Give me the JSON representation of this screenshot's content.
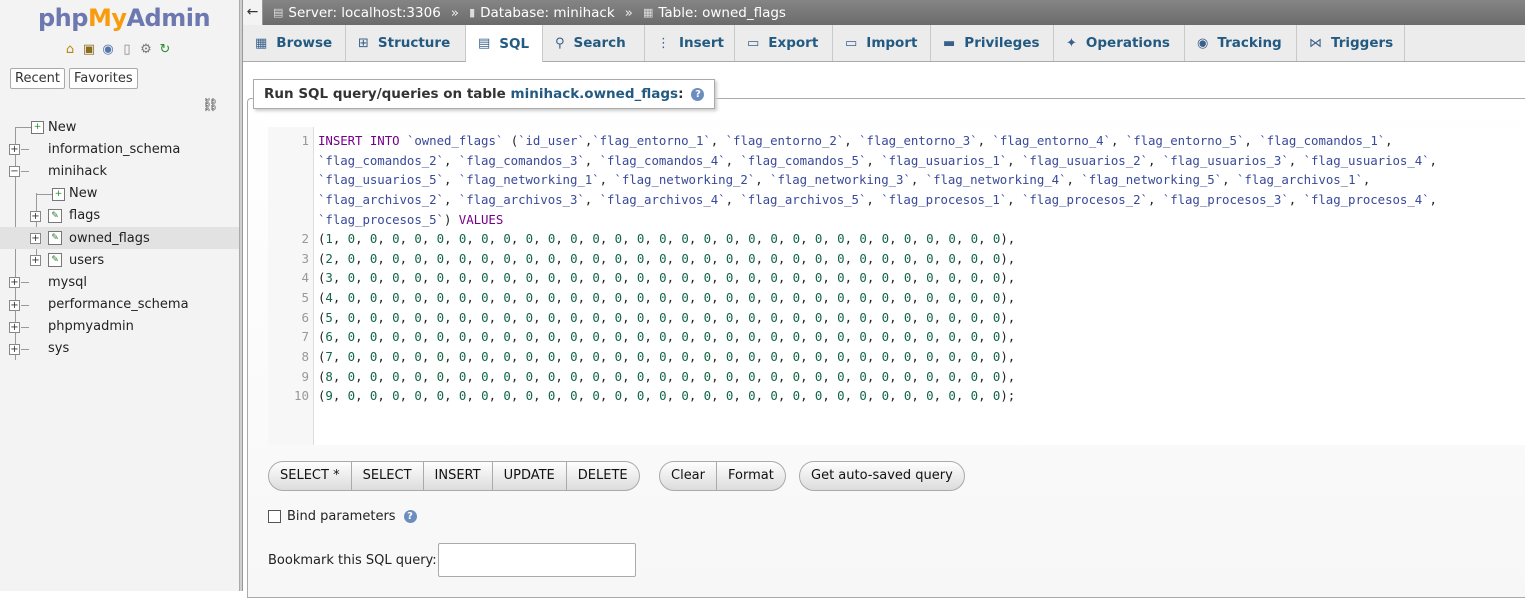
{
  "logo": {
    "php": "php",
    "my": "My",
    "admin": "Admin"
  },
  "nav": {
    "icons": [
      "home-icon",
      "exit-icon",
      "help-icon",
      "docs-icon",
      "settings-icon",
      "reload-icon"
    ],
    "tabs": [
      "Recent",
      "Favorites"
    ],
    "tree": [
      {
        "label": "New",
        "level": 0,
        "type": "new"
      },
      {
        "label": "information_schema",
        "level": 0,
        "type": "db"
      },
      {
        "label": "minihack",
        "level": 0,
        "type": "db-open"
      },
      {
        "label": "New",
        "level": 1,
        "type": "new"
      },
      {
        "label": "flags",
        "level": 1,
        "type": "table"
      },
      {
        "label": "owned_flags",
        "level": 1,
        "type": "table",
        "selected": true
      },
      {
        "label": "users",
        "level": 1,
        "type": "table"
      },
      {
        "label": "mysql",
        "level": 0,
        "type": "db"
      },
      {
        "label": "performance_schema",
        "level": 0,
        "type": "db"
      },
      {
        "label": "phpmyadmin",
        "level": 0,
        "type": "db"
      },
      {
        "label": "sys",
        "level": 0,
        "type": "db"
      }
    ]
  },
  "breadcrumb": {
    "server": "Server: localhost:3306",
    "database": "Database: minihack",
    "table": "Table: owned_flags",
    "sep": "»"
  },
  "tabs": [
    {
      "label": "Browse",
      "icon": "browse-icon"
    },
    {
      "label": "Structure",
      "icon": "structure-icon"
    },
    {
      "label": "SQL",
      "icon": "sql-icon",
      "active": true
    },
    {
      "label": "Search",
      "icon": "search-icon"
    },
    {
      "label": "Insert",
      "icon": "insert-icon"
    },
    {
      "label": "Export",
      "icon": "export-icon"
    },
    {
      "label": "Import",
      "icon": "import-icon"
    },
    {
      "label": "Privileges",
      "icon": "privileges-icon"
    },
    {
      "label": "Operations",
      "icon": "operations-icon"
    },
    {
      "label": "Tracking",
      "icon": "tracking-icon"
    },
    {
      "label": "Triggers",
      "icon": "triggers-icon"
    }
  ],
  "query_box": {
    "legend_prefix": "Run SQL query/queries on table ",
    "legend_table": "minihack.owned_flags",
    "legend_suffix": ":",
    "help": "?"
  },
  "sql": {
    "line1_rows": [
      "INSERT INTO `owned_flags` (`id_user`,`flag_entorno_1`, `flag_entorno_2`, `flag_entorno_3`, `flag_entorno_4`, `flag_entorno_5`, `flag_comandos_1`,",
      "`flag_comandos_2`, `flag_comandos_3`, `flag_comandos_4`, `flag_comandos_5`, `flag_usuarios_1`, `flag_usuarios_2`, `flag_usuarios_3`, `flag_usuarios_4`,",
      "`flag_usuarios_5`, `flag_networking_1`, `flag_networking_2`, `flag_networking_3`, `flag_networking_4`, `flag_networking_5`, `flag_archivos_1`,",
      "`flag_archivos_2`, `flag_archivos_3`, `flag_archivos_4`, `flag_archivos_5`, `flag_procesos_1`, `flag_procesos_2`, `flag_procesos_3`, `flag_procesos_4`,",
      "`flag_procesos_5`) VALUES"
    ],
    "value_rows": [
      "(1, 0, 0, 0, 0, 0, 0, 0, 0, 0, 0, 0, 0, 0, 0, 0, 0, 0, 0, 0, 0, 0, 0, 0, 0, 0, 0, 0, 0, 0, 0),",
      "(2, 0, 0, 0, 0, 0, 0, 0, 0, 0, 0, 0, 0, 0, 0, 0, 0, 0, 0, 0, 0, 0, 0, 0, 0, 0, 0, 0, 0, 0, 0),",
      "(3, 0, 0, 0, 0, 0, 0, 0, 0, 0, 0, 0, 0, 0, 0, 0, 0, 0, 0, 0, 0, 0, 0, 0, 0, 0, 0, 0, 0, 0, 0),",
      "(4, 0, 0, 0, 0, 0, 0, 0, 0, 0, 0, 0, 0, 0, 0, 0, 0, 0, 0, 0, 0, 0, 0, 0, 0, 0, 0, 0, 0, 0, 0),",
      "(5, 0, 0, 0, 0, 0, 0, 0, 0, 0, 0, 0, 0, 0, 0, 0, 0, 0, 0, 0, 0, 0, 0, 0, 0, 0, 0, 0, 0, 0, 0),",
      "(6, 0, 0, 0, 0, 0, 0, 0, 0, 0, 0, 0, 0, 0, 0, 0, 0, 0, 0, 0, 0, 0, 0, 0, 0, 0, 0, 0, 0, 0, 0),",
      "(7, 0, 0, 0, 0, 0, 0, 0, 0, 0, 0, 0, 0, 0, 0, 0, 0, 0, 0, 0, 0, 0, 0, 0, 0, 0, 0, 0, 0, 0, 0),",
      "(8, 0, 0, 0, 0, 0, 0, 0, 0, 0, 0, 0, 0, 0, 0, 0, 0, 0, 0, 0, 0, 0, 0, 0, 0, 0, 0, 0, 0, 0, 0),",
      "(9, 0, 0, 0, 0, 0, 0, 0, 0, 0, 0, 0, 0, 0, 0, 0, 0, 0, 0, 0, 0, 0, 0, 0, 0, 0, 0, 0, 0, 0, 0);"
    ],
    "line_numbers": [
      "1",
      "2",
      "3",
      "4",
      "5",
      "6",
      "7",
      "8",
      "9",
      "10"
    ]
  },
  "buttons": {
    "group1": [
      "SELECT *",
      "SELECT",
      "INSERT",
      "UPDATE",
      "DELETE"
    ],
    "group2": [
      "Clear",
      "Format"
    ],
    "group3": [
      "Get auto-saved query"
    ]
  },
  "bind_params": {
    "label": "Bind parameters",
    "help": "?"
  },
  "bookmark": {
    "label": "Bookmark this SQL query:",
    "value": ""
  }
}
